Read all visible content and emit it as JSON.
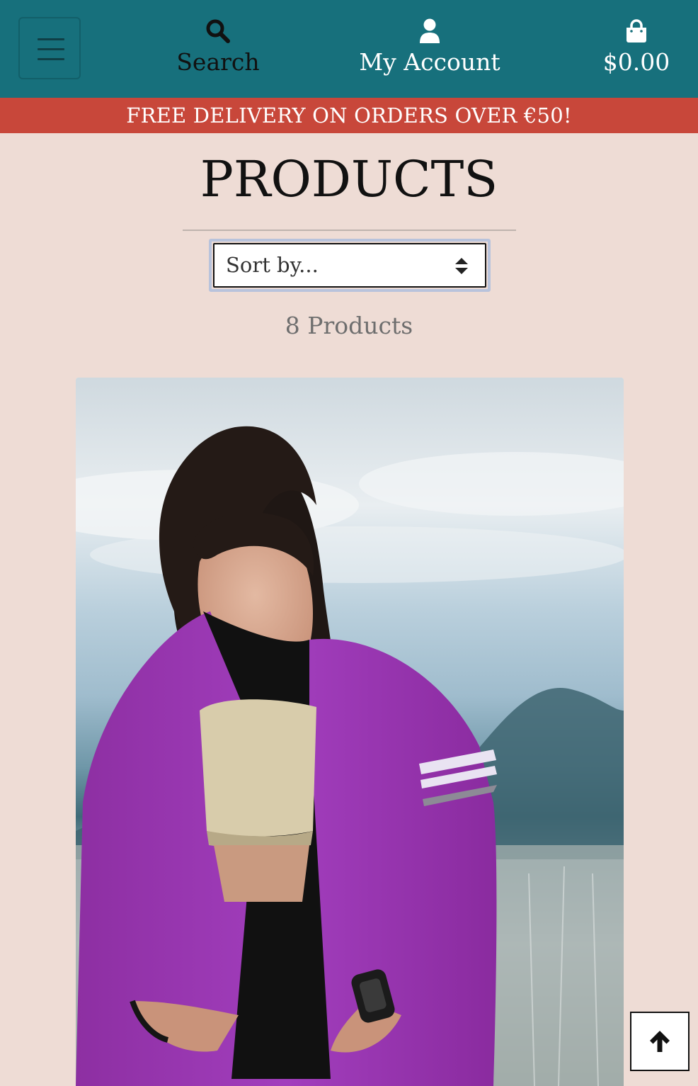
{
  "header": {
    "menu_icon": "hamburger-menu-icon",
    "search": {
      "icon": "search-icon",
      "label": "Search"
    },
    "account": {
      "icon": "user-icon",
      "label": "My Account"
    },
    "cart": {
      "icon": "shopping-bag-icon",
      "total": "$0.00"
    }
  },
  "banner": {
    "text": "FREE DELIVERY ON ORDERS OVER €50!"
  },
  "main": {
    "title": "PRODUCTS",
    "sort": {
      "selected": "Sort by...",
      "icon": "sort-arrows-icon"
    },
    "product_count": "8 Products",
    "products": [
      {
        "image": "woman in purple cycling jersey"
      }
    ]
  },
  "back_to_top": {
    "icon": "arrow-up-icon"
  },
  "colors": {
    "header_bg": "#17707c",
    "banner_bg": "#c8473a",
    "page_bg": "#eedcd5"
  }
}
